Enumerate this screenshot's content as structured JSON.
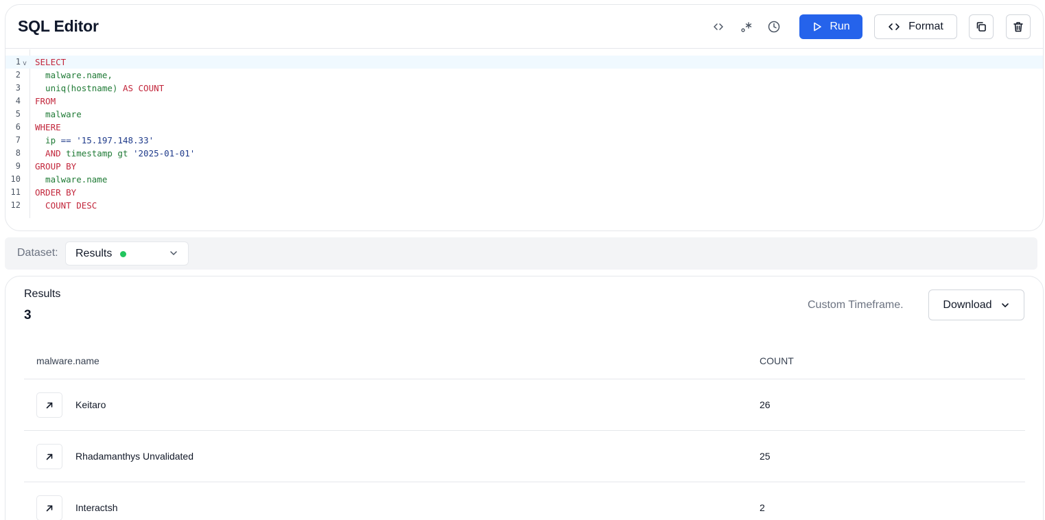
{
  "header": {
    "title": "SQL Editor",
    "icons": [
      "code-icon",
      "regex-icon",
      "history-icon"
    ],
    "run_label": "Run",
    "format_label": "Format"
  },
  "editor": {
    "lines": [
      {
        "n": "1",
        "parts": [
          [
            "kw",
            "SELECT"
          ]
        ]
      },
      {
        "n": "2",
        "parts": [
          [
            "id",
            "  malware.name,"
          ]
        ]
      },
      {
        "n": "3",
        "parts": [
          [
            "id",
            "  uniq(hostname) "
          ],
          [
            "kw",
            "AS COUNT"
          ]
        ]
      },
      {
        "n": "4",
        "parts": [
          [
            "kw",
            "FROM"
          ]
        ]
      },
      {
        "n": "5",
        "parts": [
          [
            "id",
            "  malware"
          ]
        ]
      },
      {
        "n": "6",
        "parts": [
          [
            "kw",
            "WHERE"
          ]
        ]
      },
      {
        "n": "7",
        "parts": [
          [
            "id",
            "  ip "
          ],
          [
            "op",
            "=="
          ],
          [
            "id",
            " "
          ],
          [
            "str",
            "'15.197.148.33'"
          ]
        ]
      },
      {
        "n": "8",
        "parts": [
          [
            "kw",
            "  AND "
          ],
          [
            "id",
            "timestamp gt "
          ],
          [
            "str",
            "'2025-01-01'"
          ]
        ]
      },
      {
        "n": "9",
        "parts": [
          [
            "kw",
            "GROUP BY"
          ]
        ]
      },
      {
        "n": "10",
        "parts": [
          [
            "id",
            "  malware.name"
          ]
        ]
      },
      {
        "n": "11",
        "parts": [
          [
            "kw",
            "ORDER BY"
          ]
        ]
      },
      {
        "n": "12",
        "parts": [
          [
            "kw",
            "  COUNT DESC"
          ]
        ]
      }
    ]
  },
  "dataset": {
    "label": "Dataset:",
    "value": "Results",
    "status_color": "#22c55e"
  },
  "results": {
    "label": "Results",
    "count": "3",
    "timeframe": "Custom Timeframe.",
    "download_label": "Download",
    "columns": [
      "malware.name",
      "COUNT"
    ],
    "rows": [
      {
        "name": "Keitaro",
        "count": "26"
      },
      {
        "name": "Rhadamanthys Unvalidated",
        "count": "25"
      },
      {
        "name": "Interactsh",
        "count": "2"
      }
    ]
  },
  "colors": {
    "accent": "#2563eb",
    "keyword": "#c2263b",
    "identifier": "#1f7a35",
    "string": "#1e3a8a"
  }
}
